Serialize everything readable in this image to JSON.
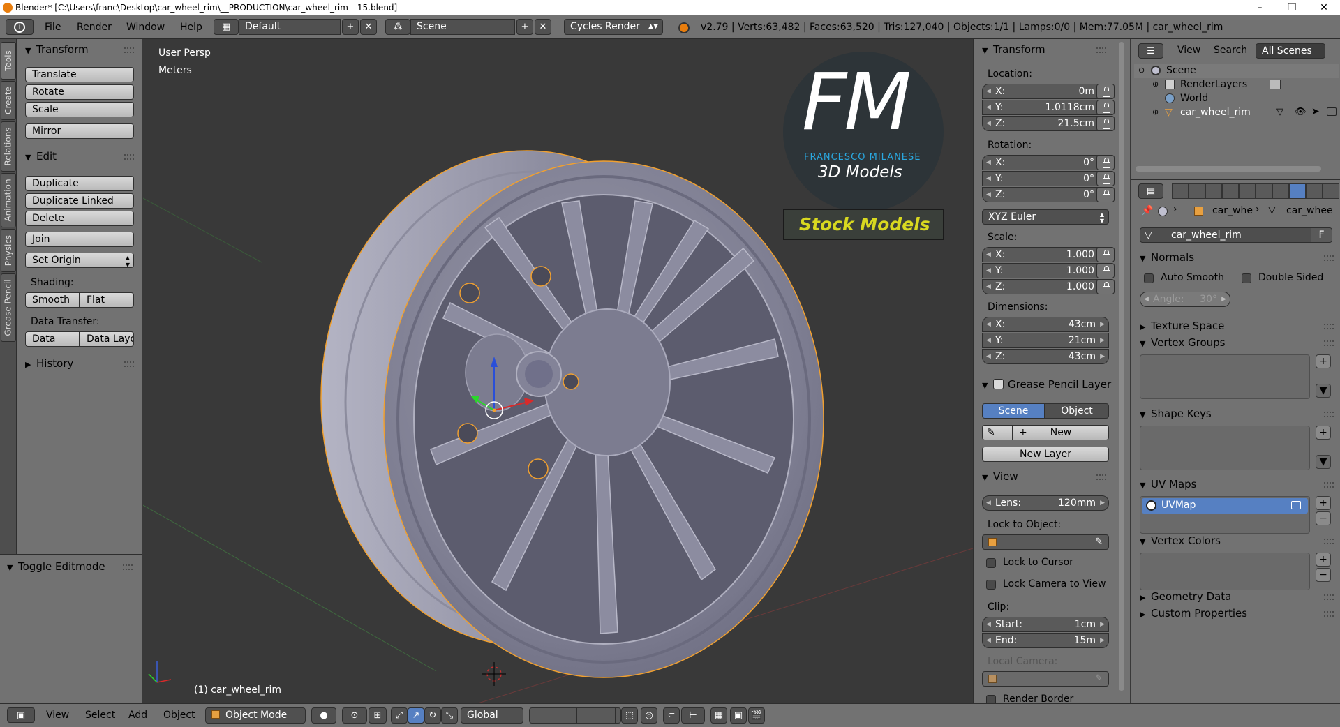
{
  "titlebar": {
    "title": "Blender* [C:\\Users\\franc\\Desktop\\car_wheel_rim\\__PRODUCTION\\car_wheel_rim---15.blend]",
    "minimize": "–",
    "maximize": "❐",
    "close": "✕"
  },
  "infobar": {
    "menus": [
      "File",
      "Render",
      "Window",
      "Help"
    ],
    "layout": "Default",
    "scene": "Scene",
    "engine": "Cycles Render",
    "stats": "v2.79 | Verts:63,482 | Faces:63,520 | Tris:127,040 | Objects:1/1 | Lamps:0/0 | Mem:77.05M | car_wheel_rim"
  },
  "sidetabs": [
    "Tools",
    "Create",
    "Relations",
    "Animation",
    "Physics",
    "Grease Pencil"
  ],
  "toolshelf": {
    "transform_header": "Transform",
    "translate": "Translate",
    "rotate": "Rotate",
    "scale": "Scale",
    "mirror": "Mirror",
    "edit_header": "Edit",
    "duplicate": "Duplicate",
    "duplicate_linked": "Duplicate Linked",
    "delete": "Delete",
    "join": "Join",
    "set_origin": "Set Origin",
    "shading_label": "Shading:",
    "smooth": "Smooth",
    "flat": "Flat",
    "data_transfer_label": "Data Transfer:",
    "data": "Data",
    "data_layout": "Data Layo",
    "history_header": "History",
    "toggle_editmode": "Toggle Editmode"
  },
  "viewport": {
    "view_name": "User Persp",
    "units": "Meters",
    "object_label": "(1) car_wheel_rim",
    "logo_letters": "FM",
    "logo_name": "FRANCESCO MILANESE",
    "logo_sub": "3D Models",
    "logo_banner": "Stock Models"
  },
  "npanel": {
    "transform_header": "Transform",
    "location_label": "Location:",
    "location": [
      {
        "axis": "X:",
        "value": "0m"
      },
      {
        "axis": "Y:",
        "value": "1.0118cm"
      },
      {
        "axis": "Z:",
        "value": "21.5cm"
      }
    ],
    "rotation_label": "Rotation:",
    "rotation": [
      {
        "axis": "X:",
        "value": "0°"
      },
      {
        "axis": "Y:",
        "value": "0°"
      },
      {
        "axis": "Z:",
        "value": "0°"
      }
    ],
    "rotation_mode": "XYZ Euler",
    "scale_label": "Scale:",
    "scale": [
      {
        "axis": "X:",
        "value": "1.000"
      },
      {
        "axis": "Y:",
        "value": "1.000"
      },
      {
        "axis": "Z:",
        "value": "1.000"
      }
    ],
    "dimensions_label": "Dimensions:",
    "dimensions": [
      {
        "axis": "X:",
        "value": "43cm"
      },
      {
        "axis": "Y:",
        "value": "21cm"
      },
      {
        "axis": "Z:",
        "value": "43cm"
      }
    ],
    "grease_header": "Grease Pencil Layer",
    "scene_tab": "Scene",
    "object_tab": "Object",
    "new": "New",
    "new_layer": "New Layer",
    "view_header": "View",
    "lens_label": "Lens:",
    "lens_value": "120mm",
    "lock_to_object": "Lock to Object:",
    "lock_to_cursor": "Lock to Cursor",
    "lock_camera": "Lock Camera to View",
    "clip_label": "Clip:",
    "clip_start_label": "Start:",
    "clip_start": "1cm",
    "clip_end_label": "End:",
    "clip_end": "15m",
    "local_camera": "Local Camera:",
    "render_border": "Render Border"
  },
  "outliner": {
    "view": "View",
    "search": "Search",
    "filter": "All Scenes",
    "scene": "Scene",
    "render_layers": "RenderLayers",
    "world": "World",
    "object": "car_wheel_rim"
  },
  "props": {
    "crumb_obj": "car_whe",
    "crumb_data": "car_whee",
    "mesh_name": "car_wheel_rim",
    "fake_user": "F",
    "normals_header": "Normals",
    "auto_smooth": "Auto Smooth",
    "double_sided": "Double Sided",
    "angle_label": "Angle:",
    "angle_value": "30°",
    "texture_space": "Texture Space",
    "vertex_groups": "Vertex Groups",
    "shape_keys": "Shape Keys",
    "uv_maps": "UV Maps",
    "uvmap": "UVMap",
    "vertex_colors": "Vertex Colors",
    "geometry_data": "Geometry Data",
    "custom_properties": "Custom Properties"
  },
  "bottombar": {
    "view": "View",
    "select": "Select",
    "add": "Add",
    "object": "Object",
    "mode": "Object Mode",
    "orientation": "Global"
  },
  "colors": {
    "viewport_bg": "#393939",
    "panel_bg": "#727272",
    "selected_blue": "#5680c2",
    "selection_outline": "#f0a030",
    "logo_blue": "#2aa8e0",
    "banner_yellow": "#d8d820"
  }
}
